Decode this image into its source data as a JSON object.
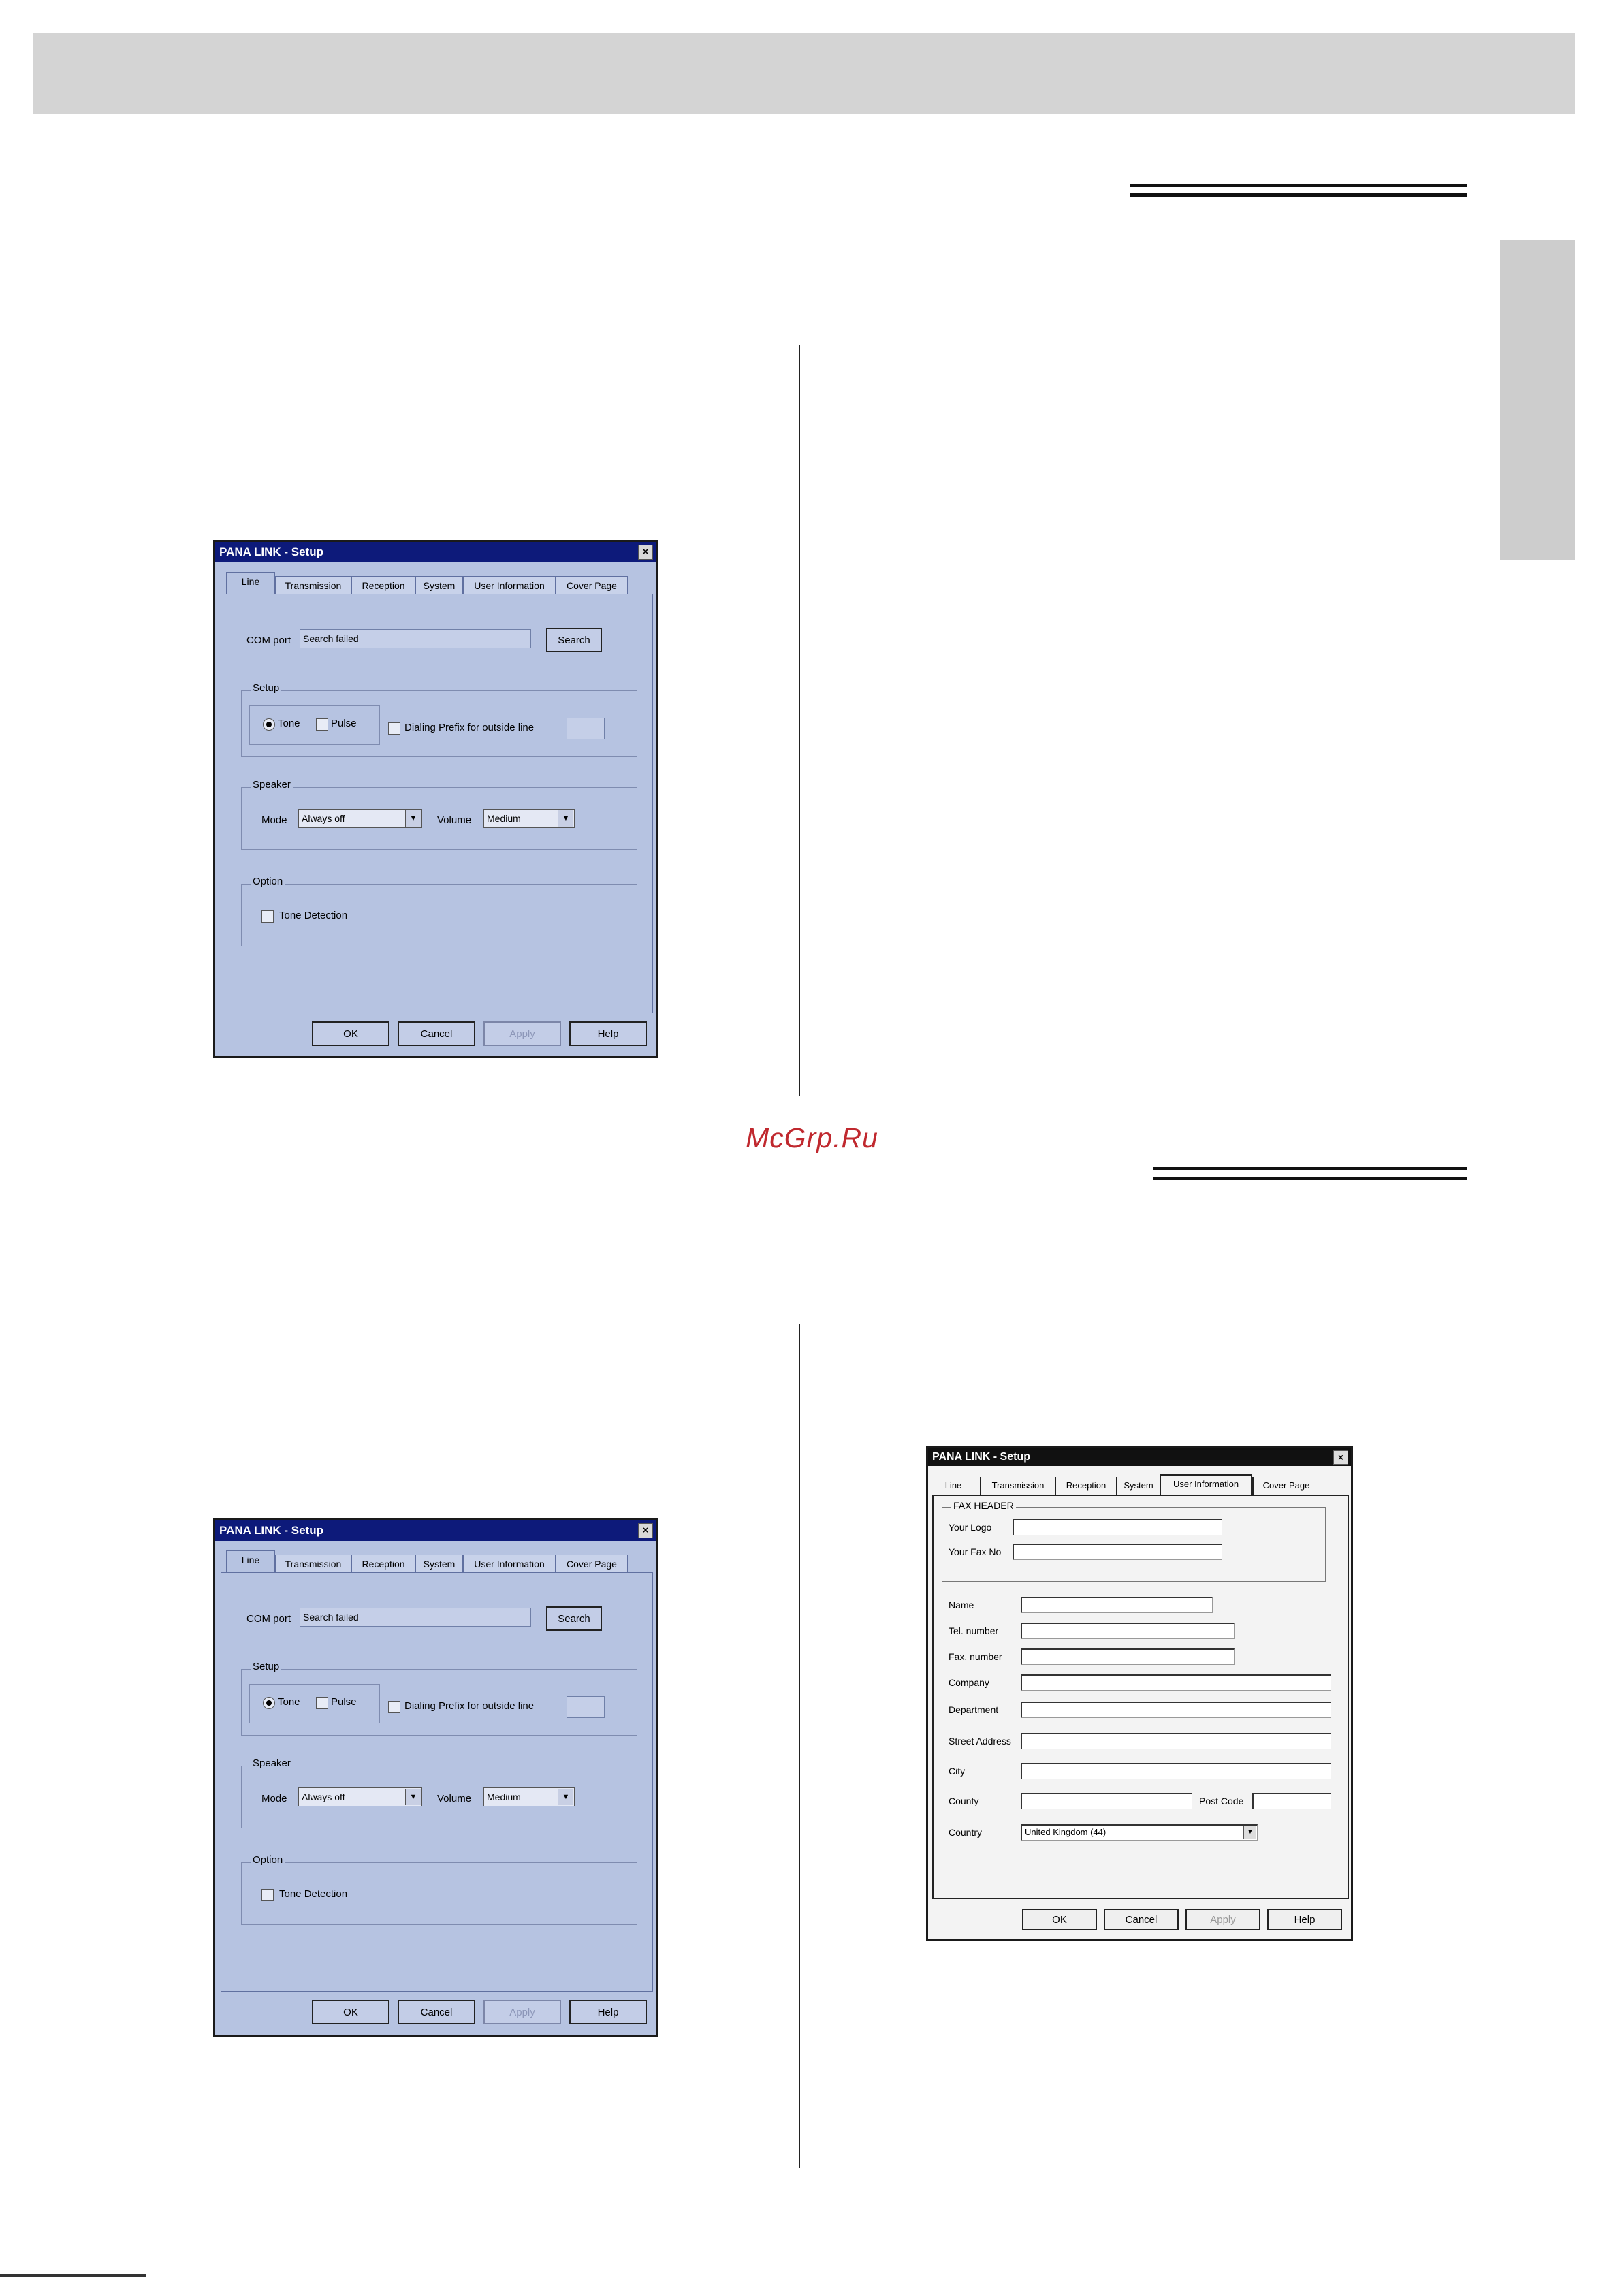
{
  "watermark": "McGrp.Ru",
  "dialog_line": {
    "title": "PANA LINK - Setup",
    "close_glyph": "×",
    "tabs": [
      "Line",
      "Transmission",
      "Reception",
      "System",
      "User Information",
      "Cover Page"
    ],
    "com_port_label": "COM port",
    "com_port_value": "Search failed",
    "search_button": "Search",
    "setup_group": "Setup",
    "tone_label": "Tone",
    "pulse_label": "Pulse",
    "prefix_label": "Dialing Prefix for outside line",
    "speaker_group": "Speaker",
    "mode_label": "Mode",
    "mode_value": "Always off",
    "volume_label": "Volume",
    "volume_value": "Medium",
    "option_group": "Option",
    "tone_detection_label": "Tone Detection",
    "buttons": {
      "ok": "OK",
      "cancel": "Cancel",
      "apply": "Apply",
      "help": "Help"
    }
  },
  "dialog_user": {
    "title": "PANA LINK - Setup",
    "close_glyph": "×",
    "tabs": [
      "Line",
      "Transmission",
      "Reception",
      "System",
      "User Information",
      "Cover Page"
    ],
    "fax_header_group": "FAX HEADER",
    "your_logo_label": "Your Logo",
    "your_fax_no_label": "Your Fax No",
    "name_label": "Name",
    "tel_label": "Tel. number",
    "fax_label": "Fax. number",
    "company_label": "Company",
    "department_label": "Department",
    "street_label": "Street Address",
    "city_label": "City",
    "county_label": "County",
    "post_code_label": "Post Code",
    "country_label": "Country",
    "country_value": "United Kingdom (44)",
    "buttons": {
      "ok": "OK",
      "cancel": "Cancel",
      "apply": "Apply",
      "help": "Help"
    }
  }
}
